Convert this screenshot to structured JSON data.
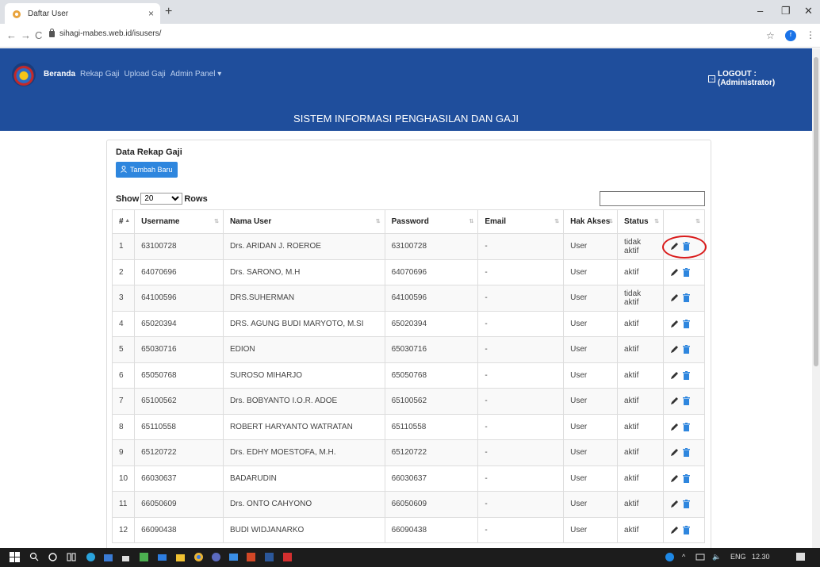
{
  "browser": {
    "tab_title": "Daftar User",
    "tab_close": "×",
    "new_tab": "+",
    "url": "sihagi-mabes.web.id/isusers/",
    "profile_initial": "f",
    "min": "–",
    "max": "❐",
    "close": "✕"
  },
  "header": {
    "nav": [
      "Beranda",
      "Rekap Gaji",
      "Upload Gaji",
      "Admin Panel ▾"
    ],
    "logout_label": "LOGOUT : (Administrator)",
    "title": "SISTEM INFORMASI PENGHASILAN DAN GAJI"
  },
  "panel": {
    "title": "Data Rekap Gaji",
    "add_button": "Tambah Baru",
    "show_label": "Show",
    "show_value": "20",
    "rows_label": "Rows"
  },
  "table": {
    "columns": [
      "#",
      "Username",
      "Nama User",
      "Password",
      "Email",
      "Hak Akses",
      "Status",
      ""
    ],
    "rows": [
      [
        "1",
        "63100728",
        "Drs. ARIDAN J. ROEROE",
        "63100728",
        "-",
        "User",
        "tidak aktif"
      ],
      [
        "2",
        "64070696",
        "Drs. SARONO, M.H",
        "64070696",
        "-",
        "User",
        "aktif"
      ],
      [
        "3",
        "64100596",
        "DRS.SUHERMAN",
        "64100596",
        "-",
        "User",
        "tidak aktif"
      ],
      [
        "4",
        "65020394",
        "DRS. AGUNG BUDI MARYOTO, M.SI",
        "65020394",
        "-",
        "User",
        "aktif"
      ],
      [
        "5",
        "65030716",
        "EDION",
        "65030716",
        "-",
        "User",
        "aktif"
      ],
      [
        "6",
        "65050768",
        "SUROSO MIHARJO",
        "65050768",
        "-",
        "User",
        "aktif"
      ],
      [
        "7",
        "65100562",
        "Drs. BOBYANTO I.O.R. ADOE",
        "65100562",
        "-",
        "User",
        "aktif"
      ],
      [
        "8",
        "65110558",
        "ROBERT HARYANTO WATRATAN",
        "65110558",
        "-",
        "User",
        "aktif"
      ],
      [
        "9",
        "65120722",
        "Drs. EDHY MOESTOFA, M.H.",
        "65120722",
        "-",
        "User",
        "aktif"
      ],
      [
        "10",
        "66030637",
        "BADARUDIN",
        "66030637",
        "-",
        "User",
        "aktif"
      ],
      [
        "11",
        "66050609",
        "Drs. ONTO CAHYONO",
        "66050609",
        "-",
        "User",
        "aktif"
      ],
      [
        "12",
        "66090438",
        "BUDI WIDJANARKO",
        "66090438",
        "-",
        "User",
        "aktif"
      ]
    ]
  },
  "taskbar": {
    "lang": "ENG",
    "time": "12.30"
  }
}
